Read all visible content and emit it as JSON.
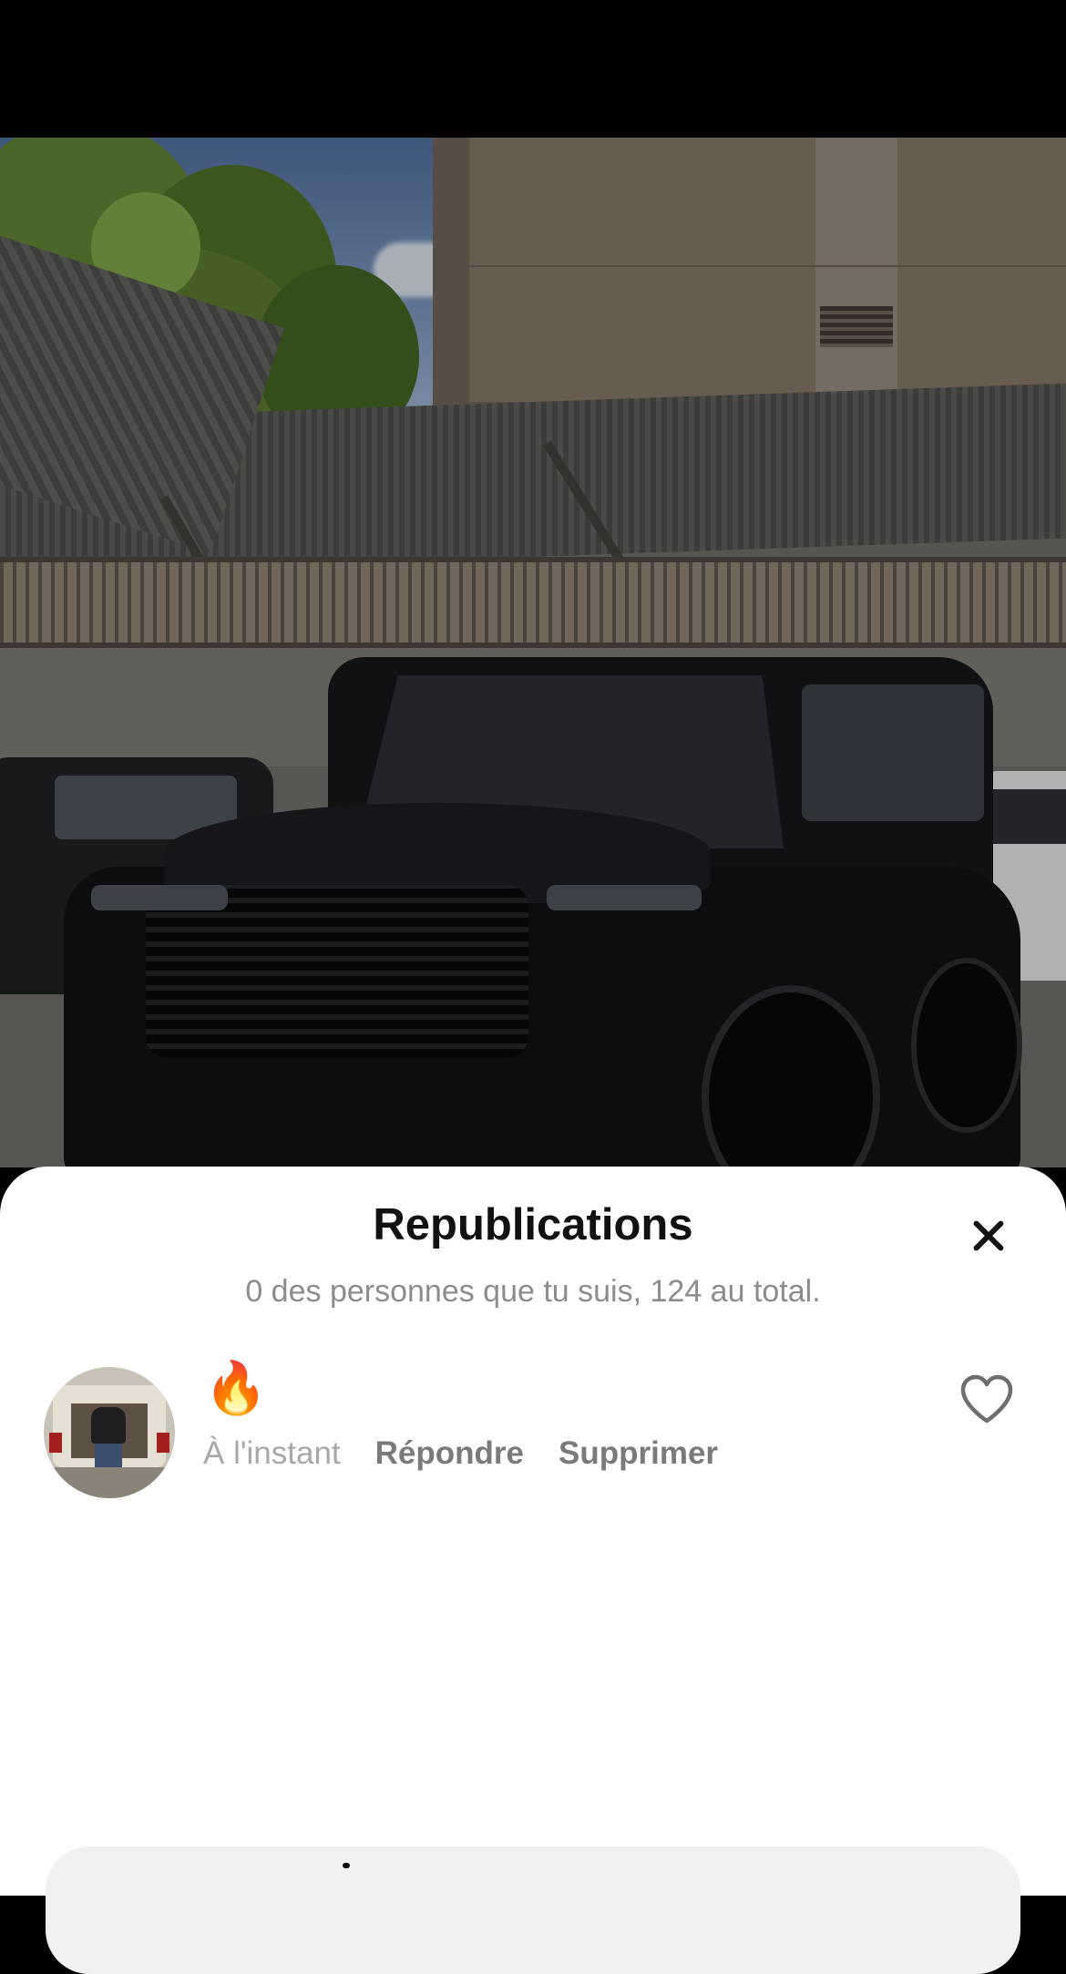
{
  "sheet": {
    "title": "Republications",
    "subtitle": "0 des personnes que tu suis, 124 au total."
  },
  "repost": {
    "emoji": "🔥",
    "time": "À l'instant",
    "reply_label": "Répondre",
    "delete_label": "Supprimer",
    "liked": false
  },
  "icons": {
    "close": "close-icon",
    "like": "heart-outline-icon"
  },
  "colors": {
    "title": "#111111",
    "subtitle": "#8c8c8c",
    "action": "#7a7a7a",
    "time": "#a8a8a8",
    "sheet_background": "#ffffff",
    "input_background": "#f1f1f2"
  }
}
